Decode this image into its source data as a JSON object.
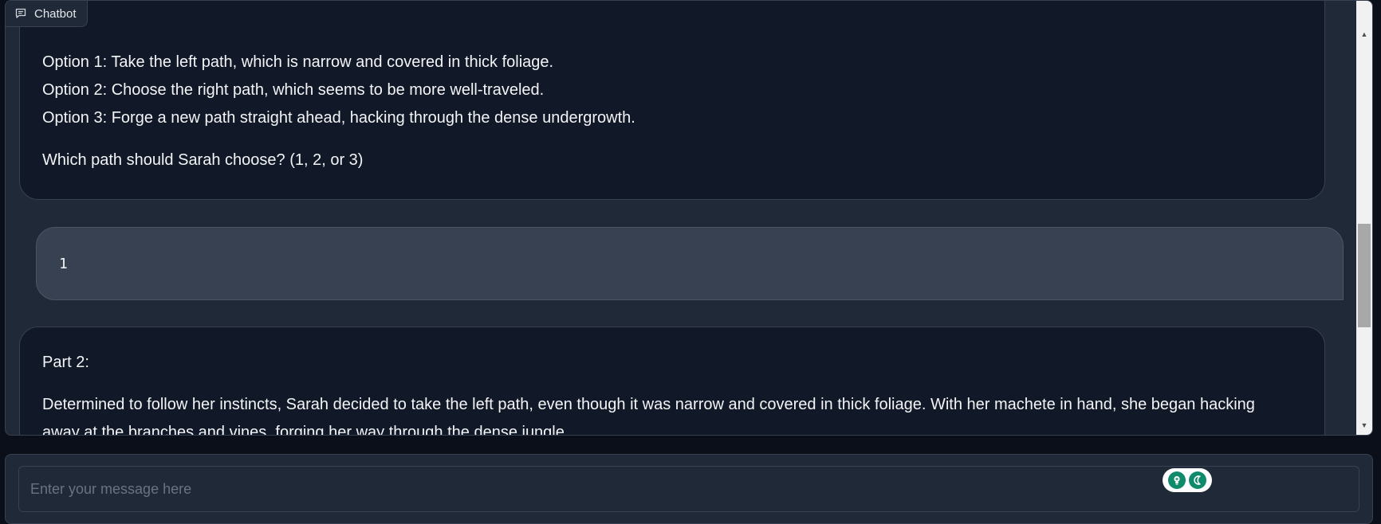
{
  "chatbot": {
    "label": "Chatbot",
    "icon": "chat-bubble-icon"
  },
  "messages": [
    {
      "role": "bot",
      "lines": [
        "Option 1: Take the left path, which is narrow and covered in thick foliage.",
        "Option 2: Choose the right path, which seems to be more well-traveled.",
        "Option 3: Forge a new path straight ahead, hacking through the dense undergrowth.",
        "Which path should Sarah choose? (1, 2, or 3)"
      ]
    },
    {
      "role": "user",
      "text": "1"
    },
    {
      "role": "bot",
      "lines": [
        "Part 2:",
        "Determined to follow her instincts, Sarah decided to take the left path, even though it was narrow and covered in thick foliage. With her machete in hand, she began hacking",
        "away at the branches and vines, forging her way through the dense jungle."
      ]
    }
  ],
  "input": {
    "placeholder": "Enter your message here",
    "value": ""
  },
  "extension_badge": {
    "icons": [
      "lightbulb-icon",
      "moon-icon"
    ]
  },
  "colors": {
    "page_bg": "#0b0f19",
    "panel_bg": "#1f2937",
    "bot_bubble": "#111827",
    "user_bubble": "#374151",
    "badge_accent": "#0f8a6b"
  }
}
